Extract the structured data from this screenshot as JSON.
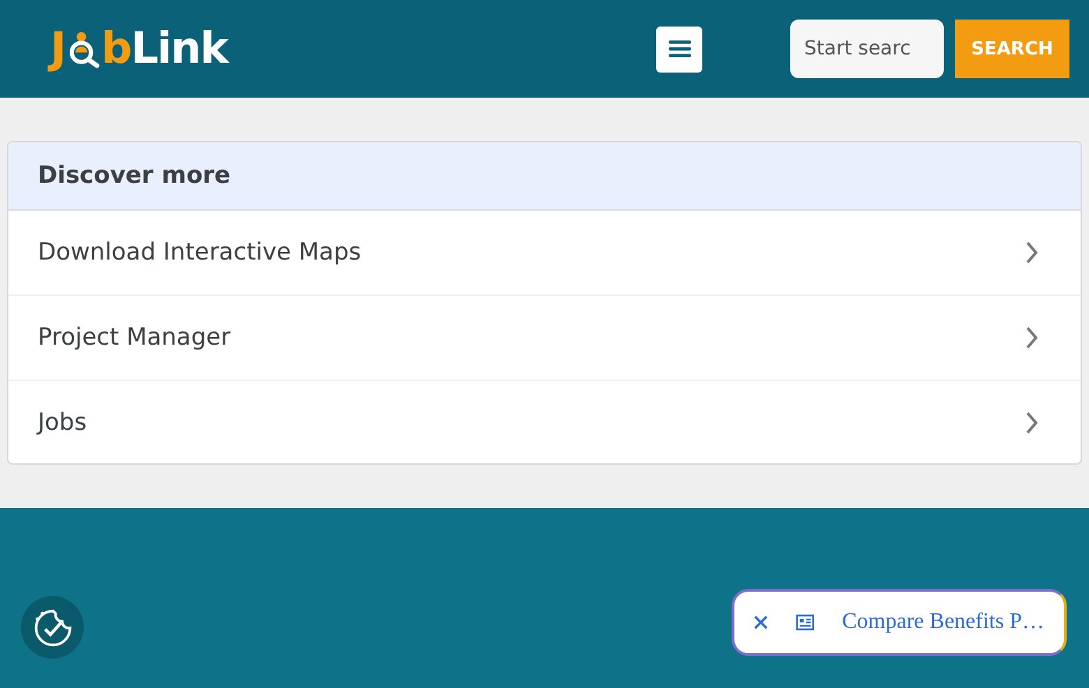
{
  "header": {
    "logo": {
      "lead": "J",
      "mid": "b",
      "tail": "Link"
    },
    "search": {
      "value": "Start searc"
    },
    "search_button": "SEARCH"
  },
  "discover": {
    "title": "Discover more",
    "items": [
      {
        "label": "Download Interactive Maps"
      },
      {
        "label": "Project Manager"
      },
      {
        "label": "Jobs"
      }
    ]
  },
  "floating_chip": {
    "label": "Compare Benefits P…"
  }
}
